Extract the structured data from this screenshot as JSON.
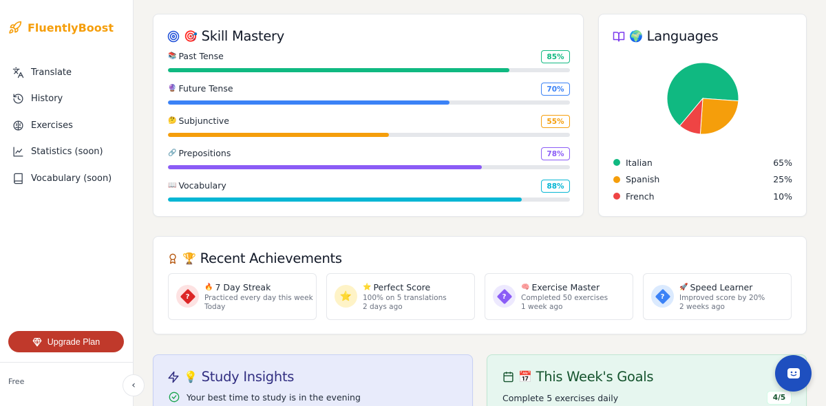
{
  "app": {
    "name": "FluentlyBoost",
    "brand_color": "#f59e0b"
  },
  "sidebar": {
    "items": [
      {
        "label": "Translate",
        "icon": "translate-icon"
      },
      {
        "label": "History",
        "icon": "history-icon"
      },
      {
        "label": "Exercises",
        "icon": "brain-icon"
      },
      {
        "label": "Statistics (soon)",
        "icon": "chart-line-icon"
      },
      {
        "label": "Vocabulary (soon)",
        "icon": "book-icon"
      }
    ],
    "upgrade_label": "Upgrade Plan",
    "plan": "Free",
    "collapse_glyph": "‹"
  },
  "skills": {
    "title": "Skill Mastery",
    "title_emoji": "🎯",
    "items": [
      {
        "emoji": "📚",
        "name": "Past Tense",
        "badge": "85%",
        "progress": 85,
        "color": "#10b981"
      },
      {
        "emoji": "🔮",
        "name": "Future Tense",
        "badge": "70%",
        "progress": 70,
        "color": "#3b82f6"
      },
      {
        "emoji": "🤔",
        "name": "Subjunctive",
        "badge": "55%",
        "progress": 55,
        "color": "#f59e0b"
      },
      {
        "emoji": "🔗",
        "name": "Prepositions",
        "badge": "78%",
        "progress": 78,
        "color": "#8b5cf6"
      },
      {
        "emoji": "📖",
        "name": "Vocabulary",
        "badge": "88%",
        "progress": 88,
        "color": "#06b6d4"
      }
    ]
  },
  "languages": {
    "title": "Languages",
    "title_emoji": "🌍",
    "items": [
      {
        "name": "Italian",
        "value": "65%",
        "color": "#10b981"
      },
      {
        "name": "Spanish",
        "value": "25%",
        "color": "#f59e0b"
      },
      {
        "name": "French",
        "value": "10%",
        "color": "#ef4444"
      }
    ]
  },
  "chart_data": {
    "type": "pie",
    "categories": [
      "Italian",
      "Spanish",
      "French"
    ],
    "values": [
      65,
      25,
      10
    ],
    "colors": [
      "#10b981",
      "#f59e0b",
      "#ef4444"
    ]
  },
  "achievements": {
    "title": "Recent Achievements",
    "title_emoji": "🏆",
    "items": [
      {
        "emoji": "🔥",
        "name": "7 Day Streak",
        "desc": "Practiced every day this week",
        "time": "Today",
        "icon_bg": "#fde2e2",
        "glyph_color": "#dc2626",
        "glyph": "?"
      },
      {
        "emoji": "⭐",
        "name": "Perfect Score",
        "desc": "100% on 5 translations",
        "time": "2 days ago",
        "icon_bg": "#fef3c7",
        "glyph_color": "#f59e0b",
        "glyph": "⭐"
      },
      {
        "emoji": "🧠",
        "name": "Exercise Master",
        "desc": "Completed 50 exercises",
        "time": "1 week ago",
        "icon_bg": "#ede9fe",
        "glyph_color": "#8b5cf6",
        "glyph": "?"
      },
      {
        "emoji": "🚀",
        "name": "Speed Learner",
        "desc": "Improved score by 20%",
        "time": "2 weeks ago",
        "icon_bg": "#dbeafe",
        "glyph_color": "#3b82f6",
        "glyph": "?"
      }
    ]
  },
  "insights": {
    "title": "Study Insights",
    "title_emoji": "💡",
    "first": "Your best time to study is in the evening"
  },
  "goals": {
    "title": "This Week's Goals",
    "title_emoji": "📅",
    "first": {
      "label": "Complete 5 exercises daily",
      "badge": "4/5"
    }
  }
}
